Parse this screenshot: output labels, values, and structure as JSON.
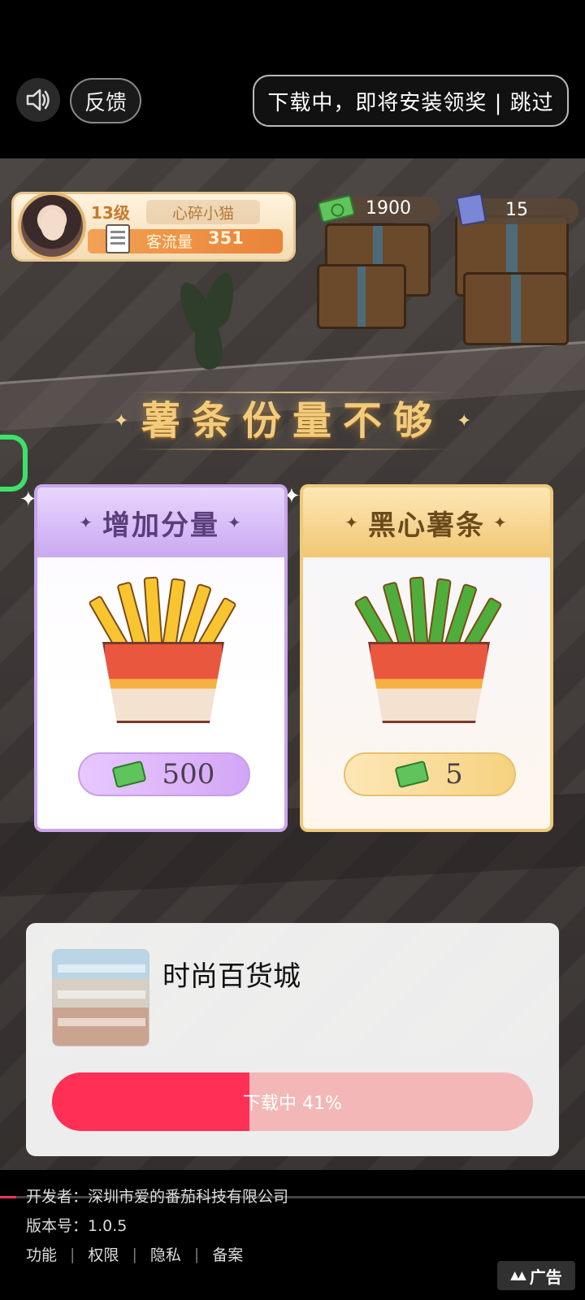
{
  "topbar": {
    "feedback_label": "反馈",
    "skip_label": "下载中，即将安装领奖 | 跳过",
    "sound_icon": "speaker-icon"
  },
  "player": {
    "level": "13级",
    "nickname": "心碎小猫",
    "traffic_label": "客流量",
    "traffic_value": "351"
  },
  "currency": {
    "money": "1900",
    "books": "15"
  },
  "event": {
    "headline": "薯条份量不够",
    "options": [
      {
        "title": "增加分量",
        "price": "500",
        "fries_color": "#f8c531"
      },
      {
        "title": "黑心薯条",
        "price": "5",
        "fries_color": "#4fae3b"
      }
    ]
  },
  "dialog": {
    "app_name": "时尚百货城",
    "progress_label": "下载中 41%",
    "progress": 0.41
  },
  "footer": {
    "developer": "开发者：深圳市爱的番茄科技有限公司",
    "version": "版本号：1.0.5",
    "links": [
      "功能",
      "权限",
      "隐私",
      "备案"
    ],
    "ad_label": "广告"
  },
  "colors": {
    "accent": "#ff2f55",
    "progress_track": "#f3b7b7"
  }
}
